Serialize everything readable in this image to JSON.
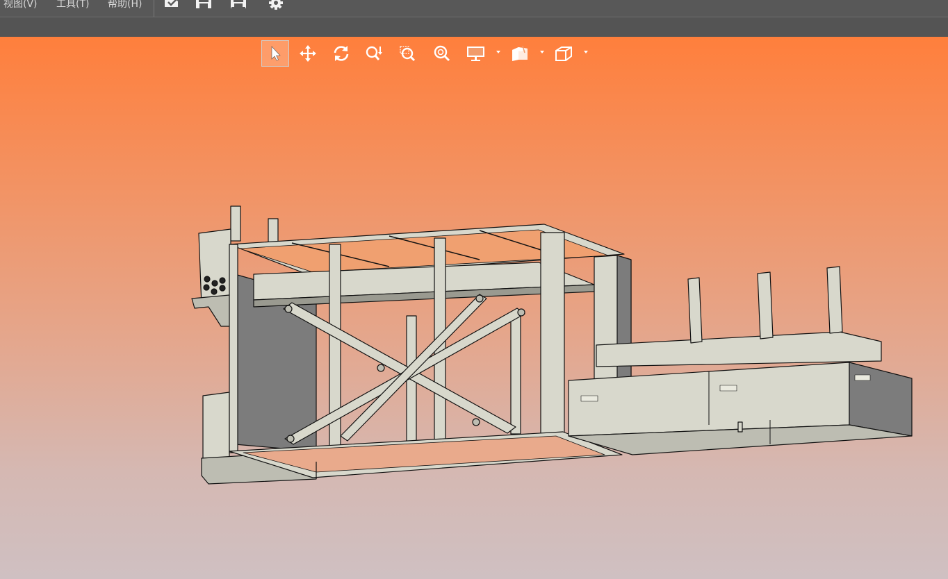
{
  "menu": {
    "items": [
      {
        "label": "视图(V)"
      },
      {
        "label": "工具(T)"
      },
      {
        "label": "帮助(H)"
      }
    ]
  },
  "toolbar": {
    "icons": [
      "open-icon",
      "save-icon",
      "save-as-icon",
      "gear-icon"
    ]
  },
  "view_toolbar": {
    "tools": [
      {
        "name": "select-tool",
        "icon": "cursor-arrow-icon",
        "active": true
      },
      {
        "name": "pan-tool",
        "icon": "move-arrows-icon"
      },
      {
        "name": "rotate-tool",
        "icon": "rotate-icon"
      },
      {
        "name": "zoom-tool",
        "icon": "zoom-icon"
      },
      {
        "name": "zoom-window-tool",
        "icon": "zoom-window-icon"
      },
      {
        "name": "zoom-fit-tool",
        "icon": "zoom-fit-icon"
      },
      {
        "name": "display-mode-dropdown",
        "icon": "monitor-icon"
      },
      {
        "name": "section-view-dropdown",
        "icon": "section-cube-icon"
      },
      {
        "name": "view-orientation-dropdown",
        "icon": "iso-cube-icon"
      }
    ]
  },
  "colors": {
    "menubar": "#585858",
    "ribbon": "#545454",
    "viewport_top": "#ff7f3c",
    "viewport_bottom": "#cfc0c2",
    "model_fill": "#d8d8cc",
    "model_shade": "#7a7a7a",
    "model_edge": "#111111"
  }
}
